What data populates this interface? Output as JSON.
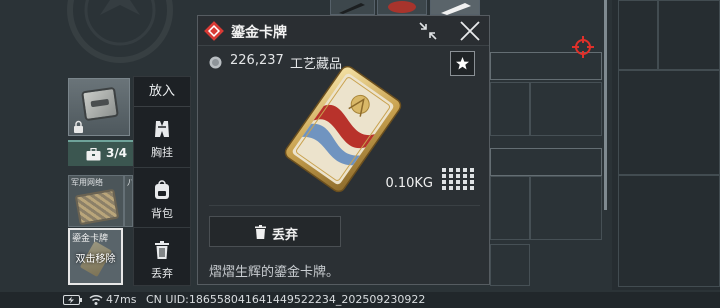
{
  "popup": {
    "title": "鎏金卡牌",
    "price": "226,237",
    "category": "工艺藏品",
    "weight": "0.10KG",
    "discard_label": "丢弃",
    "description": "熠熠生辉的鎏金卡牌。",
    "icons": [
      "diamond-icon",
      "collapse-icon",
      "close-icon",
      "coin-icon",
      "star-icon",
      "grid-icon",
      "trash-icon"
    ]
  },
  "context_menu": {
    "header": "放入",
    "items": [
      {
        "label": "胸挂",
        "icon": "vest-icon"
      },
      {
        "label": "背包",
        "icon": "backpack-icon"
      },
      {
        "label": "丢弃",
        "icon": "trash-icon"
      }
    ]
  },
  "container": {
    "capacity": "3/4",
    "icon": "briefcase-icon"
  },
  "slots": [
    {
      "label": "军用网络"
    },
    {
      "label": "八"
    }
  ],
  "selected_slot": {
    "label": "鎏金卡牌",
    "hint": "双击移除"
  },
  "status_bar": {
    "ping": "47ms",
    "uid": "CN UID:186558041641449522234_202509230922",
    "icons": [
      "battery-icon",
      "wifi-icon"
    ]
  },
  "colors": {
    "background": "#2b3337",
    "accent_red": "#d93a35",
    "gold": "#c9a24f",
    "capacity_bar": "#3b5650",
    "menu_bg": "#1d2125"
  }
}
